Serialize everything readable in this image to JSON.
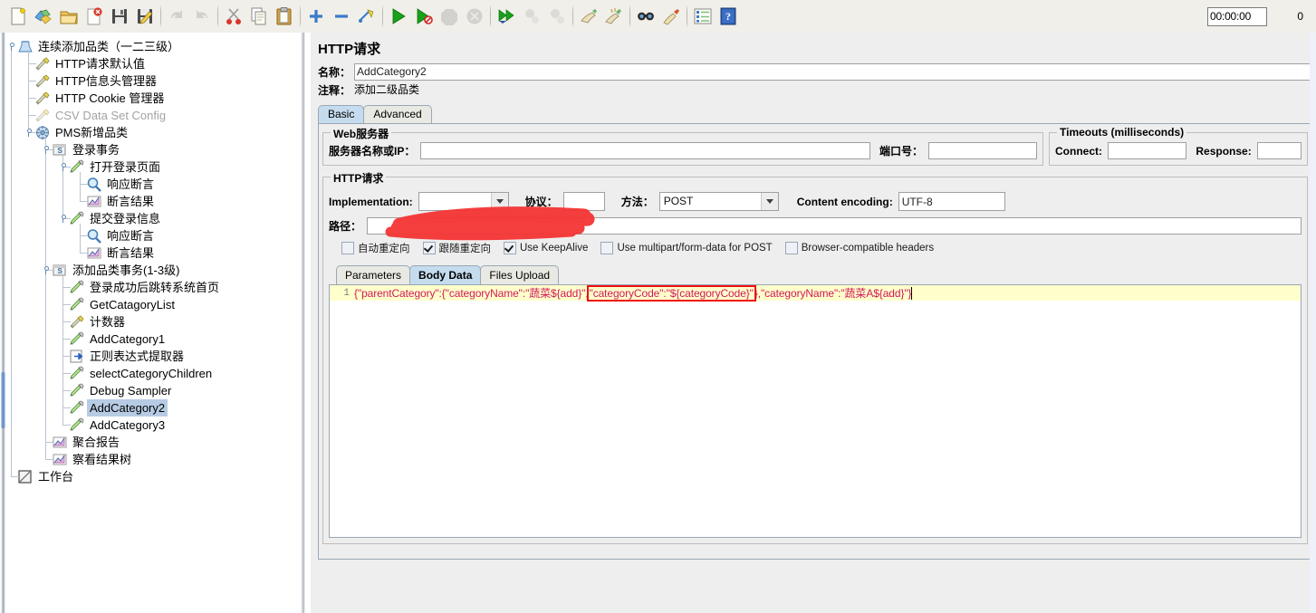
{
  "toolbar": {
    "buttons": [
      {
        "name": "new-icon",
        "title": "New"
      },
      {
        "name": "templates-icon",
        "title": "Templates"
      },
      {
        "name": "open-icon",
        "title": "Open"
      },
      {
        "name": "close-icon",
        "title": "Close"
      },
      {
        "name": "save-icon",
        "title": "Save"
      },
      {
        "name": "save-as-icon",
        "title": "Save as"
      },
      {
        "name": "undo-icon",
        "title": "Undo"
      },
      {
        "name": "redo-icon",
        "title": "Redo"
      },
      {
        "name": "cut-icon",
        "title": "Cut"
      },
      {
        "name": "copy-icon",
        "title": "Copy"
      },
      {
        "name": "paste-icon",
        "title": "Paste"
      },
      {
        "name": "expand-all-icon",
        "title": "Expand all"
      },
      {
        "name": "collapse-all-icon",
        "title": "Collapse all"
      },
      {
        "name": "toggle-icon",
        "title": "Toggle"
      },
      {
        "name": "start-icon",
        "title": "Start"
      },
      {
        "name": "start-no-timers-icon",
        "title": "Start no pauses"
      },
      {
        "name": "stop-icon",
        "title": "Stop"
      },
      {
        "name": "shutdown-icon",
        "title": "Shutdown"
      },
      {
        "name": "remote-start-all-icon",
        "title": "Remote start all"
      },
      {
        "name": "remote-stop-all-icon",
        "title": "Remote stop all"
      },
      {
        "name": "remote-shutdown-all-icon",
        "title": "Remote shutdown all"
      },
      {
        "name": "clear-icon",
        "title": "Clear"
      },
      {
        "name": "clear-all-icon",
        "title": "Clear all"
      },
      {
        "name": "search-icon",
        "title": "Search"
      },
      {
        "name": "search-reset-icon",
        "title": "Reset search"
      },
      {
        "name": "function-helper-icon",
        "title": "Function helper dialog"
      },
      {
        "name": "help-icon",
        "title": "Help"
      }
    ],
    "timer": "00:00:00",
    "thread_count": "0"
  },
  "tree": {
    "nodes": [
      {
        "label": "连续添加品类（一二三级）",
        "icon": "test-plan-icon",
        "indent": 0,
        "state": "normal"
      },
      {
        "label": "HTTP请求默认值",
        "icon": "config-icon",
        "indent": 1,
        "state": "normal"
      },
      {
        "label": "HTTP信息头管理器",
        "icon": "config-icon",
        "indent": 1,
        "state": "normal"
      },
      {
        "label": "HTTP Cookie 管理器",
        "icon": "config-icon",
        "indent": 1,
        "state": "normal"
      },
      {
        "label": "CSV Data Set Config",
        "icon": "config-icon",
        "indent": 1,
        "state": "disabled"
      },
      {
        "label": "PMS新增品类",
        "icon": "thread-group-icon",
        "indent": 1,
        "state": "normal"
      },
      {
        "label": "登录事务",
        "icon": "transaction-controller-icon",
        "indent": 2,
        "state": "normal"
      },
      {
        "label": "打开登录页面",
        "icon": "sampler-icon",
        "indent": 3,
        "state": "normal"
      },
      {
        "label": "响应断言",
        "icon": "assertion-icon",
        "indent": 4,
        "state": "normal"
      },
      {
        "label": "断言结果",
        "icon": "listener-icon",
        "indent": 4,
        "state": "normal"
      },
      {
        "label": "提交登录信息",
        "icon": "sampler-icon",
        "indent": 3,
        "state": "normal"
      },
      {
        "label": "响应断言",
        "icon": "assertion-icon",
        "indent": 4,
        "state": "normal"
      },
      {
        "label": "断言结果",
        "icon": "listener-icon",
        "indent": 4,
        "state": "normal"
      },
      {
        "label": "添加品类事务(1-3级)",
        "icon": "transaction-controller-icon",
        "indent": 2,
        "state": "normal"
      },
      {
        "label": "登录成功后跳转系统首页",
        "icon": "sampler-icon",
        "indent": 3,
        "state": "normal"
      },
      {
        "label": "GetCatagoryList",
        "icon": "sampler-icon",
        "indent": 3,
        "state": "normal"
      },
      {
        "label": "计数器",
        "icon": "config-icon",
        "indent": 3,
        "state": "normal"
      },
      {
        "label": "AddCategory1",
        "icon": "sampler-icon",
        "indent": 3,
        "state": "normal"
      },
      {
        "label": "正则表达式提取器",
        "icon": "post-processor-icon",
        "indent": 3,
        "state": "normal"
      },
      {
        "label": "selectCategoryChildren",
        "icon": "sampler-icon",
        "indent": 3,
        "state": "normal"
      },
      {
        "label": "Debug Sampler",
        "icon": "sampler-icon",
        "indent": 3,
        "state": "normal"
      },
      {
        "label": "AddCategory2",
        "icon": "sampler-icon",
        "indent": 3,
        "state": "selected"
      },
      {
        "label": "AddCategory3",
        "icon": "sampler-icon",
        "indent": 3,
        "state": "normal"
      },
      {
        "label": "聚合报告",
        "icon": "listener-icon",
        "indent": 2,
        "state": "normal"
      },
      {
        "label": "察看结果树",
        "icon": "listener-icon",
        "indent": 2,
        "state": "normal"
      },
      {
        "label": "工作台",
        "icon": "workbench-icon",
        "indent": 0,
        "state": "normal"
      }
    ]
  },
  "main": {
    "title": "HTTP请求",
    "name_label": "名称：",
    "name_value": "AddCategory2",
    "comment_label": "注释：",
    "comment_value": "添加二级品类",
    "tabs": [
      {
        "label": "Basic",
        "active": true
      },
      {
        "label": "Advanced",
        "active": false
      }
    ],
    "web_server": {
      "title": "Web服务器",
      "server_label": "服务器名称或IP：",
      "server_value": "",
      "port_label": "端口号：",
      "port_value": ""
    },
    "timeouts": {
      "title": "Timeouts (milliseconds)",
      "connect_label": "Connect:",
      "connect_value": "",
      "response_label": "Response:",
      "response_value": ""
    },
    "http_request": {
      "title": "HTTP请求",
      "implementation_label": "Implementation:",
      "implementation_value": "",
      "protocol_label": "协议：",
      "protocol_value": "",
      "method_label": "方法：",
      "method_value": "POST",
      "content_encoding_label": "Content encoding:",
      "content_encoding_value": "UTF-8",
      "path_label": "路径：",
      "path_value": ""
    },
    "checkboxes": [
      {
        "label": "自动重定向",
        "checked": false
      },
      {
        "label": "跟随重定向",
        "checked": true
      },
      {
        "label": "Use KeepAlive",
        "checked": true
      },
      {
        "label": "Use multipart/form-data for POST",
        "checked": false
      },
      {
        "label": "Browser-compatible headers",
        "checked": false
      }
    ],
    "data_tabs": [
      {
        "label": "Parameters",
        "active": false
      },
      {
        "label": "Body Data",
        "active": true
      },
      {
        "label": "Files Upload",
        "active": false
      }
    ],
    "body_data": {
      "line_number": "1",
      "segment_1": "{\"parentCategory\":{\"categoryName\":\"蔬菜${add}\",",
      "segment_highlighted": "\"categoryCode\":\"${categoryCode}\"",
      "segment_2": "},\"categoryName\":\"蔬菜A${add}\"}"
    }
  },
  "colors": {
    "accent": "#c5dbee",
    "selection": "#b7cce4",
    "editor_bg": "#ffffcc",
    "highlight_border": "#ee1111",
    "annotation_red": "#f03030",
    "string_color": "#d2185b"
  }
}
